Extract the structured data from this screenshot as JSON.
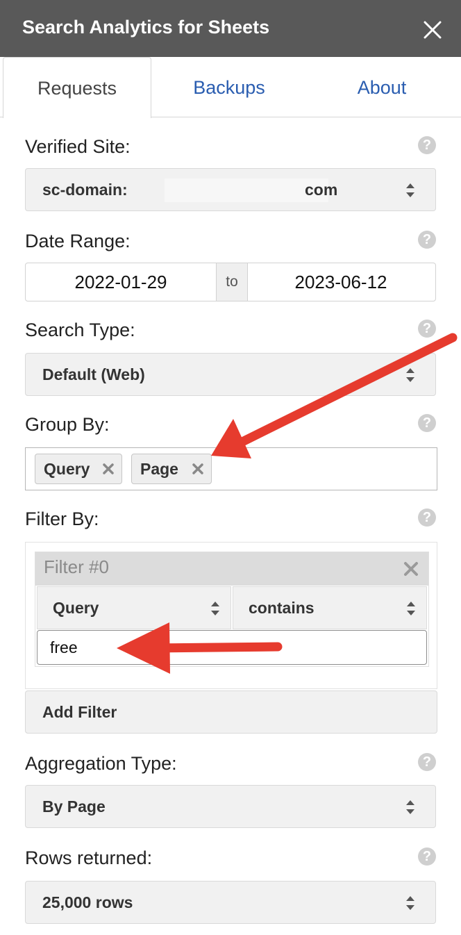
{
  "window": {
    "title": "Search Analytics for Sheets"
  },
  "tabs": [
    {
      "label": "Requests",
      "active": true
    },
    {
      "label": "Backups",
      "active": false
    },
    {
      "label": "About",
      "active": false
    }
  ],
  "verified_site": {
    "label": "Verified Site:",
    "value_prefix": "sc-domain:",
    "value_suffix": "com"
  },
  "date_range": {
    "label": "Date Range:",
    "start": "2022-01-29",
    "separator": "to",
    "end": "2023-06-12"
  },
  "search_type": {
    "label": "Search Type:",
    "value": "Default (Web)"
  },
  "group_by": {
    "label": "Group By:",
    "chips": [
      {
        "label": "Query"
      },
      {
        "label": "Page"
      }
    ]
  },
  "filter_by": {
    "label": "Filter By:",
    "filters": [
      {
        "title": "Filter #0",
        "dimension": "Query",
        "operator": "contains",
        "expression": "free"
      }
    ],
    "add_label": "Add Filter"
  },
  "aggregation_type": {
    "label": "Aggregation Type:",
    "value": "By Page"
  },
  "rows_returned": {
    "label": "Rows returned:",
    "value": "25,000 rows"
  },
  "help_glyph": "?",
  "colors": {
    "titlebar": "#595959",
    "link": "#2a5db0",
    "annotation_arrow": "#e63b2e"
  }
}
